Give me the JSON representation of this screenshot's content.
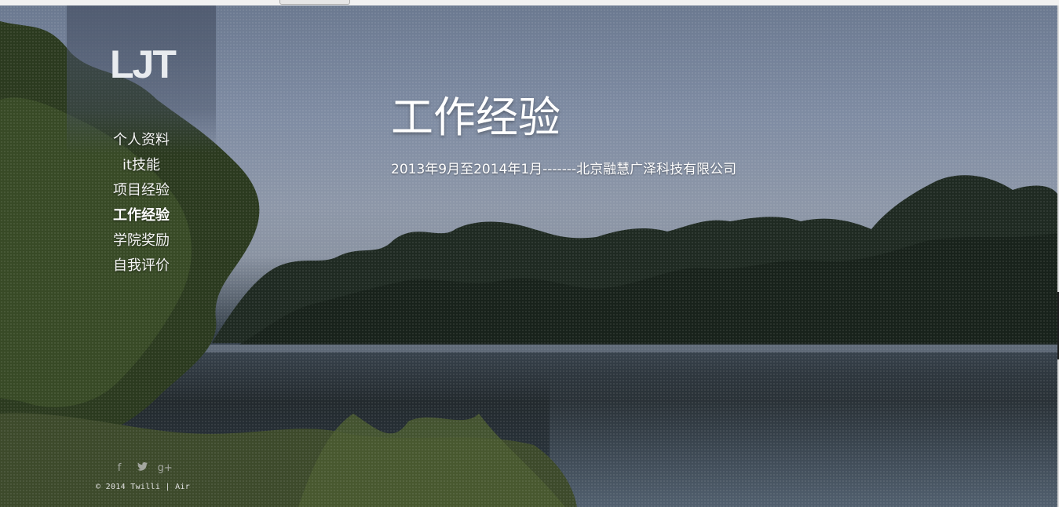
{
  "sidebar": {
    "logo": "LJT",
    "nav": [
      {
        "label": "个人资料",
        "active": false
      },
      {
        "label": "it技能",
        "active": false
      },
      {
        "label": "项目经验",
        "active": false
      },
      {
        "label": "工作经验",
        "active": true
      },
      {
        "label": "学院奖励",
        "active": false
      },
      {
        "label": "自我评价",
        "active": false
      }
    ],
    "social": [
      {
        "icon": "facebook-icon",
        "glyph": "f"
      },
      {
        "icon": "twitter-icon",
        "glyph": "🐦"
      },
      {
        "icon": "google-plus-icon",
        "glyph": "g+"
      }
    ],
    "footer": "© 2014 Twilli | Air"
  },
  "main": {
    "title": "工作经验",
    "entry": "2013年9月至2014年1月-------北京融慧广泽科技有限公司"
  },
  "colors": {
    "text": "#ffffff",
    "sky": "#7f8ca3",
    "water": "#1d2428"
  }
}
